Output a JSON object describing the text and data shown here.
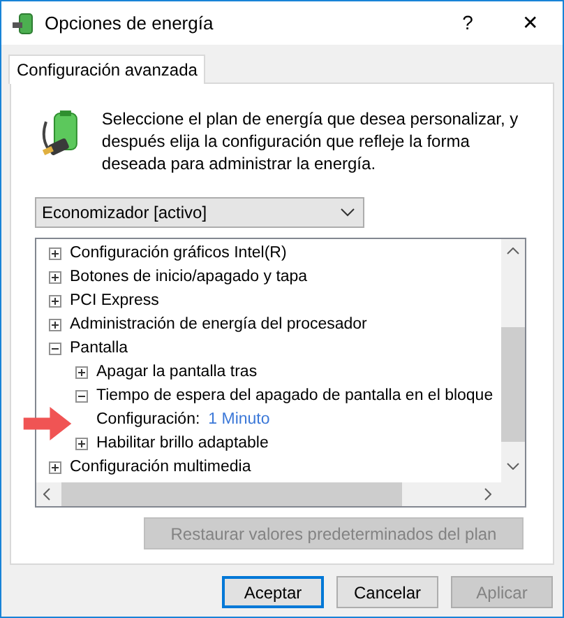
{
  "window": {
    "title": "Opciones de energía",
    "help": "?",
    "close": "✕"
  },
  "tabs": [
    {
      "label": "Configuración avanzada",
      "selected": true
    }
  ],
  "description": "Seleccione el plan de energía que desea personalizar, y después elija la configuración que refleje la forma deseada para administrar la energía.",
  "plan_dropdown": {
    "value": "Economizador [activo]"
  },
  "tree": {
    "items": [
      {
        "label": "Configuración gráficos Intel(R)",
        "expanded": false
      },
      {
        "label": "Botones de inicio/apagado y tapa",
        "expanded": false
      },
      {
        "label": "PCI Express",
        "expanded": false
      },
      {
        "label": "Administración de energía del procesador",
        "expanded": false
      },
      {
        "label": "Pantalla",
        "expanded": true,
        "children": [
          {
            "label": "Apagar la pantalla tras",
            "expanded": false
          },
          {
            "label": "Tiempo de espera del apagado de pantalla en el bloque",
            "expanded": true,
            "children": [
              {
                "kind": "setting",
                "label": "Configuración:",
                "value": "1 Minuto"
              }
            ]
          },
          {
            "label": "Habilitar brillo adaptable",
            "expanded": false
          }
        ]
      },
      {
        "label": "Configuración multimedia",
        "expanded": false
      }
    ]
  },
  "restore_button": {
    "label": "Restaurar valores predeterminados del plan",
    "disabled": true
  },
  "buttons": [
    {
      "label": "Aceptar",
      "focused": true,
      "disabled": false
    },
    {
      "label": "Cancelar",
      "focused": false,
      "disabled": false
    },
    {
      "label": "Aplicar",
      "focused": false,
      "disabled": true
    }
  ]
}
